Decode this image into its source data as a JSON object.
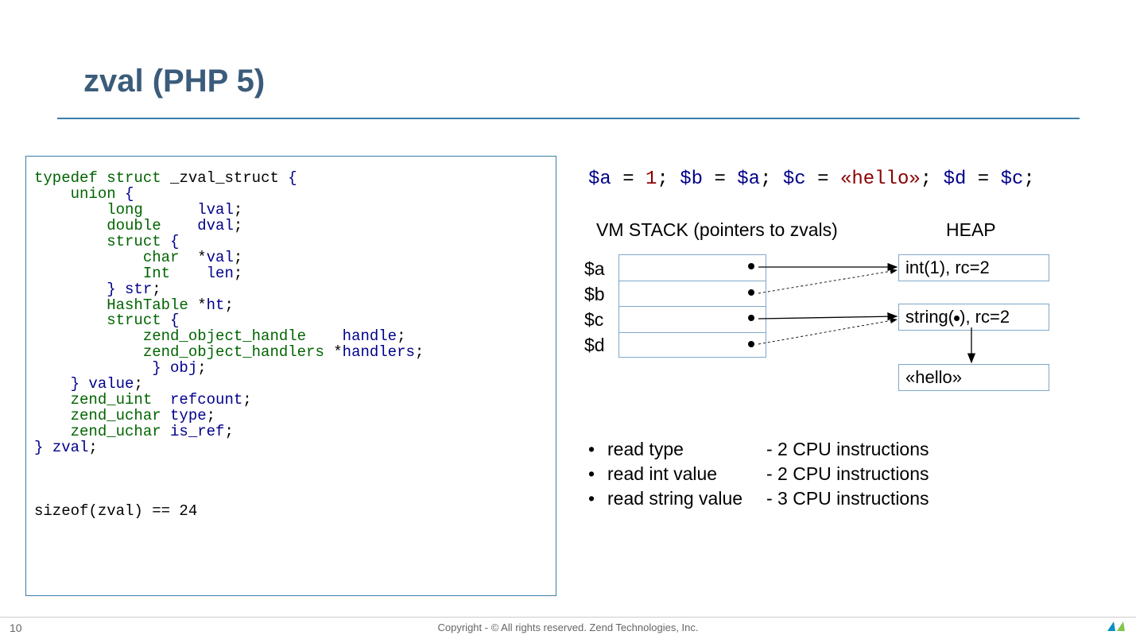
{
  "title": "zval (PHP 5)",
  "code": {
    "l1a": "typedef",
    "l1b": " struct",
    "l1c": " _zval_struct ",
    "l1d": "{",
    "l2a": "    union ",
    "l2b": "{",
    "l3a": "        long      ",
    "l3b": "lval",
    "l3c": ";",
    "l4a": "        double    ",
    "l4b": "dval",
    "l4c": ";",
    "l5a": "        struct ",
    "l5b": "{",
    "l6a": "            char  ",
    "l6b": "*",
    "l6c": "val",
    "l6d": ";",
    "l7a": "            Int   ",
    "l7b": " len",
    "l7c": ";",
    "l8a": "        } ",
    "l8b": "str",
    "l8c": ";",
    "l9a": "        HashTable ",
    "l9b": "*",
    "l9c": "ht",
    "l9d": ";",
    "l10a": "        struct ",
    "l10b": "{",
    "l11a": "            zend_object_handle   ",
    "l11b": " handle",
    "l11c": ";",
    "l12a": "            zend_object_handlers ",
    "l12b": "*",
    "l12c": "handlers",
    "l12d": ";",
    "l13a": "             } ",
    "l13b": "obj",
    "l13c": ";",
    "l14a": "    } ",
    "l14b": "value",
    "l14c": ";",
    "l15a": "    zend_uint  ",
    "l15b": "refcount",
    "l15c": ";",
    "l16a": "    zend_uchar ",
    "l16b": "type",
    "l16c": ";",
    "l17a": "    zend_uchar ",
    "l17b": "is_ref",
    "l17c": ";",
    "l18a": "} ",
    "l18b": "zval",
    "l18c": ";",
    "sizeof": "sizeof(zval) == 24"
  },
  "assign": {
    "a": "$a",
    "eq": " = ",
    "one": "1",
    "semi": "; ",
    "b": "$b",
    "aval": "$a",
    "c": "$c",
    "hello": "«hello»",
    "d": "$d",
    "cval": "$c",
    "end": ";"
  },
  "diagram": {
    "vm_label": "VM STACK (pointers to zvals)",
    "heap_label": "HEAP",
    "vars": [
      "$a",
      "$b",
      "$c",
      "$d"
    ],
    "heap1": "int(1), rc=2",
    "heap2a": "string(",
    "heap2b": "), rc=2",
    "heap3": "«hello»"
  },
  "bullets": {
    "r1l": "read type",
    "r1r": "- 2 CPU instructions",
    "r2l": "read int value",
    "r2r": "- 2 CPU instructions",
    "r3l": "read string value",
    "r3r": "- 3 CPU instructions"
  },
  "footer": {
    "page": "10",
    "copyright": "Copyright - © All rights reserved. Zend Technologies, Inc."
  }
}
